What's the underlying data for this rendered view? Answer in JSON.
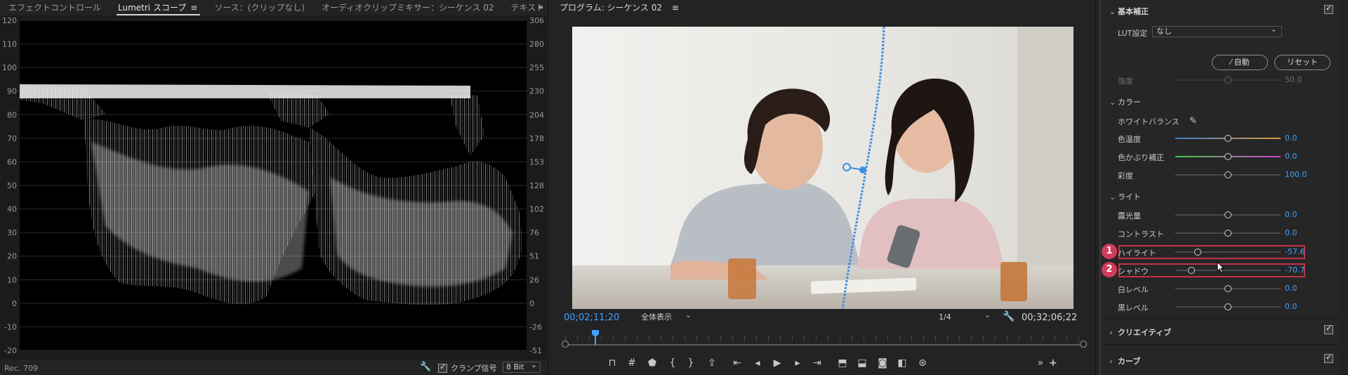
{
  "left_panel": {
    "tabs": [
      "エフェクトコントロール",
      "Lumetri スコープ",
      "ソース：(クリップなし)",
      "オーディオクリップミキサー：シーケンス 02",
      "テキスト"
    ],
    "active_tab_menu": "≡",
    "more": "»",
    "scope": {
      "left_axis": [
        "120",
        "110",
        "100",
        "90",
        "80",
        "70",
        "60",
        "50",
        "40",
        "30",
        "20",
        "10",
        "0",
        "-10",
        "-20"
      ],
      "right_axis": [
        "306",
        "280",
        "255",
        "230",
        "204",
        "178",
        "153",
        "128",
        "102",
        "76",
        "51",
        "26",
        "0",
        "-26",
        "-51"
      ]
    },
    "footer": {
      "colorspace": "Rec. 709",
      "clamp_label": "クランプ信号",
      "bit_depth": "8 Bit"
    }
  },
  "program_monitor": {
    "title": "プログラム: シーケンス 02",
    "menu": "≡",
    "timecode_current": "00;02;11;20",
    "fit": "全体表示",
    "resolution": "1/4",
    "timecode_duration": "00;32;06;22",
    "transport_icons": [
      "marker-in-icon",
      "grid-icon",
      "marker-icon",
      "mark-in-icon",
      "mark-out-icon",
      "export-frame-icon",
      "go-to-in-icon",
      "step-back-icon",
      "play-icon",
      "step-forward-icon",
      "go-to-out-icon",
      "lift-icon",
      "extract-icon",
      "camera-icon",
      "compare-icon",
      "vr-icon",
      "more-icon",
      "add-icon"
    ]
  },
  "lumetri": {
    "basic_section": "基本補正",
    "lut_label": "LUT設定",
    "lut_value": "なし",
    "auto_label": "自動",
    "reset_label": "リセット",
    "strength_label": "強度",
    "strength_value": "50.0",
    "color_section": "カラー",
    "white_balance_label": "ホワイトバランス",
    "light_section": "ライト",
    "creative_section": "クリエイティブ",
    "curves_section": "カーブ",
    "sliders": {
      "temperature": {
        "label": "色温度",
        "value": "0.0",
        "pos": 0.5
      },
      "tint": {
        "label": "色かぶり補正",
        "value": "0.0",
        "pos": 0.5
      },
      "saturation": {
        "label": "彩度",
        "value": "100.0",
        "pos": 0.5
      },
      "exposure": {
        "label": "露光量",
        "value": "0.0",
        "pos": 0.5
      },
      "contrast": {
        "label": "コントラスト",
        "value": "0.0",
        "pos": 0.5
      },
      "highlights": {
        "label": "ハイライト",
        "value": "-57.6",
        "pos": 0.21
      },
      "shadows": {
        "label": "シャドウ",
        "value": "-70.7",
        "pos": 0.15
      },
      "whites": {
        "label": "白レベル",
        "value": "0.0",
        "pos": 0.5
      },
      "blacks": {
        "label": "黒レベル",
        "value": "0.0",
        "pos": 0.5
      }
    },
    "badges": [
      "1",
      "2"
    ],
    "accent_color": "#3ea3ff",
    "highlight_color": "#c0324b"
  }
}
